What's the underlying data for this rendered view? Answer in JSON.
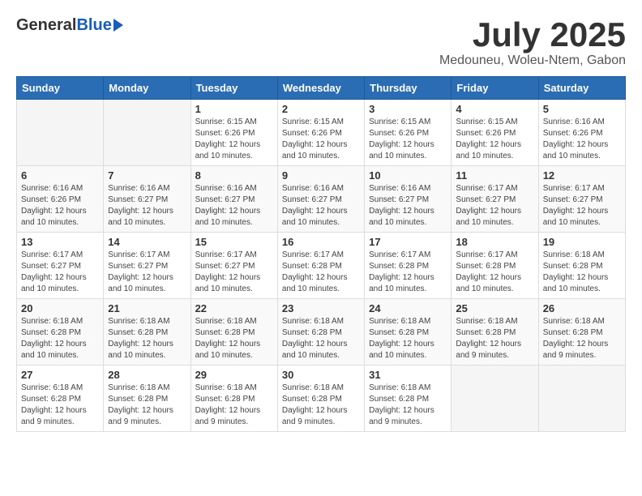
{
  "header": {
    "logo_general": "General",
    "logo_blue": "Blue",
    "month_title": "July 2025",
    "location": "Medouneu, Woleu-Ntem, Gabon"
  },
  "weekdays": [
    "Sunday",
    "Monday",
    "Tuesday",
    "Wednesday",
    "Thursday",
    "Friday",
    "Saturday"
  ],
  "weeks": [
    [
      {
        "day": "",
        "info": ""
      },
      {
        "day": "",
        "info": ""
      },
      {
        "day": "1",
        "info": "Sunrise: 6:15 AM\nSunset: 6:26 PM\nDaylight: 12 hours and 10 minutes."
      },
      {
        "day": "2",
        "info": "Sunrise: 6:15 AM\nSunset: 6:26 PM\nDaylight: 12 hours and 10 minutes."
      },
      {
        "day": "3",
        "info": "Sunrise: 6:15 AM\nSunset: 6:26 PM\nDaylight: 12 hours and 10 minutes."
      },
      {
        "day": "4",
        "info": "Sunrise: 6:15 AM\nSunset: 6:26 PM\nDaylight: 12 hours and 10 minutes."
      },
      {
        "day": "5",
        "info": "Sunrise: 6:16 AM\nSunset: 6:26 PM\nDaylight: 12 hours and 10 minutes."
      }
    ],
    [
      {
        "day": "6",
        "info": "Sunrise: 6:16 AM\nSunset: 6:26 PM\nDaylight: 12 hours and 10 minutes."
      },
      {
        "day": "7",
        "info": "Sunrise: 6:16 AM\nSunset: 6:27 PM\nDaylight: 12 hours and 10 minutes."
      },
      {
        "day": "8",
        "info": "Sunrise: 6:16 AM\nSunset: 6:27 PM\nDaylight: 12 hours and 10 minutes."
      },
      {
        "day": "9",
        "info": "Sunrise: 6:16 AM\nSunset: 6:27 PM\nDaylight: 12 hours and 10 minutes."
      },
      {
        "day": "10",
        "info": "Sunrise: 6:16 AM\nSunset: 6:27 PM\nDaylight: 12 hours and 10 minutes."
      },
      {
        "day": "11",
        "info": "Sunrise: 6:17 AM\nSunset: 6:27 PM\nDaylight: 12 hours and 10 minutes."
      },
      {
        "day": "12",
        "info": "Sunrise: 6:17 AM\nSunset: 6:27 PM\nDaylight: 12 hours and 10 minutes."
      }
    ],
    [
      {
        "day": "13",
        "info": "Sunrise: 6:17 AM\nSunset: 6:27 PM\nDaylight: 12 hours and 10 minutes."
      },
      {
        "day": "14",
        "info": "Sunrise: 6:17 AM\nSunset: 6:27 PM\nDaylight: 12 hours and 10 minutes."
      },
      {
        "day": "15",
        "info": "Sunrise: 6:17 AM\nSunset: 6:27 PM\nDaylight: 12 hours and 10 minutes."
      },
      {
        "day": "16",
        "info": "Sunrise: 6:17 AM\nSunset: 6:28 PM\nDaylight: 12 hours and 10 minutes."
      },
      {
        "day": "17",
        "info": "Sunrise: 6:17 AM\nSunset: 6:28 PM\nDaylight: 12 hours and 10 minutes."
      },
      {
        "day": "18",
        "info": "Sunrise: 6:17 AM\nSunset: 6:28 PM\nDaylight: 12 hours and 10 minutes."
      },
      {
        "day": "19",
        "info": "Sunrise: 6:18 AM\nSunset: 6:28 PM\nDaylight: 12 hours and 10 minutes."
      }
    ],
    [
      {
        "day": "20",
        "info": "Sunrise: 6:18 AM\nSunset: 6:28 PM\nDaylight: 12 hours and 10 minutes."
      },
      {
        "day": "21",
        "info": "Sunrise: 6:18 AM\nSunset: 6:28 PM\nDaylight: 12 hours and 10 minutes."
      },
      {
        "day": "22",
        "info": "Sunrise: 6:18 AM\nSunset: 6:28 PM\nDaylight: 12 hours and 10 minutes."
      },
      {
        "day": "23",
        "info": "Sunrise: 6:18 AM\nSunset: 6:28 PM\nDaylight: 12 hours and 10 minutes."
      },
      {
        "day": "24",
        "info": "Sunrise: 6:18 AM\nSunset: 6:28 PM\nDaylight: 12 hours and 10 minutes."
      },
      {
        "day": "25",
        "info": "Sunrise: 6:18 AM\nSunset: 6:28 PM\nDaylight: 12 hours and 9 minutes."
      },
      {
        "day": "26",
        "info": "Sunrise: 6:18 AM\nSunset: 6:28 PM\nDaylight: 12 hours and 9 minutes."
      }
    ],
    [
      {
        "day": "27",
        "info": "Sunrise: 6:18 AM\nSunset: 6:28 PM\nDaylight: 12 hours and 9 minutes."
      },
      {
        "day": "28",
        "info": "Sunrise: 6:18 AM\nSunset: 6:28 PM\nDaylight: 12 hours and 9 minutes."
      },
      {
        "day": "29",
        "info": "Sunrise: 6:18 AM\nSunset: 6:28 PM\nDaylight: 12 hours and 9 minutes."
      },
      {
        "day": "30",
        "info": "Sunrise: 6:18 AM\nSunset: 6:28 PM\nDaylight: 12 hours and 9 minutes."
      },
      {
        "day": "31",
        "info": "Sunrise: 6:18 AM\nSunset: 6:28 PM\nDaylight: 12 hours and 9 minutes."
      },
      {
        "day": "",
        "info": ""
      },
      {
        "day": "",
        "info": ""
      }
    ]
  ]
}
